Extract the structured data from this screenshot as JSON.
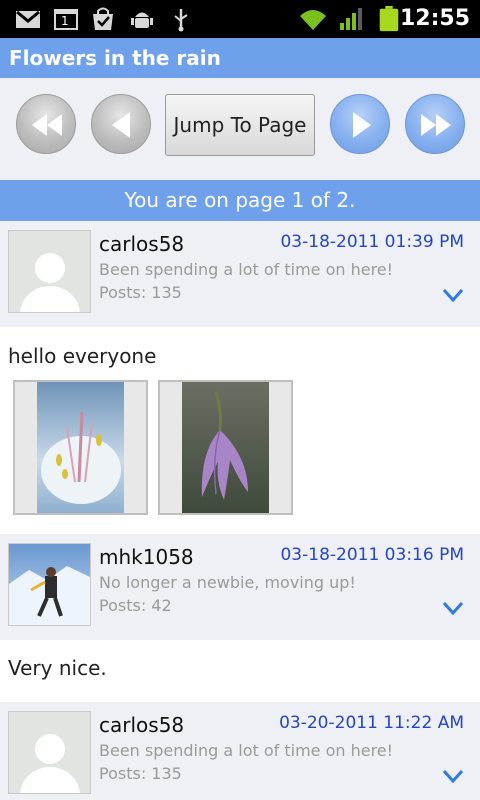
{
  "status_bar": {
    "time": "12:55",
    "icons": [
      "gmail-icon",
      "calendar-icon",
      "market-icon",
      "android-debug-icon",
      "usb-icon",
      "wifi-icon",
      "signal-icon",
      "battery-icon"
    ],
    "calendar_day": "1"
  },
  "app": {
    "title": "Flowers in the rain"
  },
  "nav": {
    "jump_label": "Jump To Page",
    "page_indicator": "You are on page 1 of 2."
  },
  "colors": {
    "accent": "#6ea0ec",
    "date_text": "#2345c8",
    "header_bg": "#eef0f6"
  },
  "posts": [
    {
      "username": "carlos58",
      "date": "03-18-2011 01:39 PM",
      "rank": "Been spending a lot of time on here!",
      "posts": "Posts: 135",
      "body": "hello everyone",
      "attachments": [
        "flower-closeup-image",
        "purple-flower-image"
      ]
    },
    {
      "username": "mhk1058",
      "date": "03-18-2011 03:16 PM",
      "rank": "No longer a newbie, moving up!",
      "posts": "Posts: 42",
      "body": "Very nice."
    },
    {
      "username": "carlos58",
      "date": "03-20-2011 11:22 AM",
      "rank": "Been spending a lot of time on here!",
      "posts": "Posts: 135"
    }
  ]
}
